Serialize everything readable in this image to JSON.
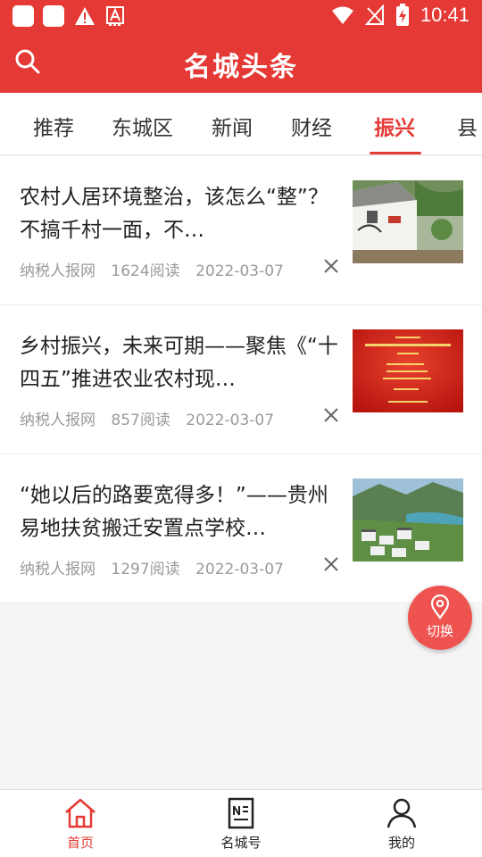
{
  "status_bar": {
    "time": "10:41"
  },
  "app_bar": {
    "title": "名城头条"
  },
  "tabs": [
    {
      "label": "推荐"
    },
    {
      "label": "东城区"
    },
    {
      "label": "新闻"
    },
    {
      "label": "财经"
    },
    {
      "label": "振兴",
      "active": true
    },
    {
      "label": "县"
    }
  ],
  "news": [
    {
      "title": "农村人居环境整治，该怎么“整”？ 不搞千村一面，不…",
      "source": "纳税人报网",
      "reads": "1624阅读",
      "date": "2022-03-07"
    },
    {
      "title": "乡村振兴，未来可期——聚焦《“十四五”推进农业农村现…",
      "source": "纳税人报网",
      "reads": "857阅读",
      "date": "2022-03-07"
    },
    {
      "title": "“她以后的路要宽得多！”——贵州易地扶贫搬迁安置点学校…",
      "source": "纳税人报网",
      "reads": "1297阅读",
      "date": "2022-03-07"
    }
  ],
  "fab": {
    "label": "切换"
  },
  "bottom_nav": [
    {
      "label": "首页",
      "active": true
    },
    {
      "label": "名城号"
    },
    {
      "label": "我的"
    }
  ],
  "colors": {
    "brand": "#e53935",
    "fab": "#ef5350",
    "meta_text": "#9a9a9a"
  }
}
